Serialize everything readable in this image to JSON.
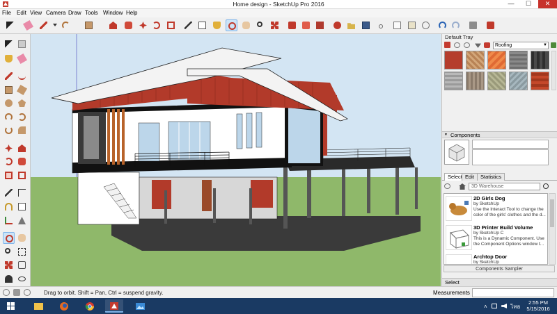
{
  "window": {
    "title": "Home design - SketchUp Pro 2016",
    "minimize": "—",
    "maximize": "☐",
    "close": "✕"
  },
  "menu": [
    "File",
    "Edit",
    "View",
    "Camera",
    "Draw",
    "Tools",
    "Window",
    "Help"
  ],
  "tray": {
    "title": "Default Tray",
    "material_library": "Roofing",
    "components_header": "Components",
    "tabs": [
      "Select",
      "Edit",
      "Statistics"
    ],
    "search_placeholder": "3D Warehouse",
    "results": [
      {
        "title": "2D Girls Dog",
        "by": "by SketchUp",
        "desc": "Use the Interact Tool to change the color of the girls' clothes and the d..."
      },
      {
        "title": "3D Printer Build Volume",
        "by": "by SketchUp C",
        "desc": "This is a Dynamic Component. Use the Component Options window t..."
      },
      {
        "title": "Archtop Door",
        "by": "by SketchUp",
        "desc": ""
      }
    ],
    "sampler": "Components Sampler",
    "select_bar": "Select"
  },
  "status": {
    "message": "Drag to orbit. Shift = Pan, Ctrl = suspend gravity.",
    "measurements_label": "Measurements"
  },
  "taskbar": {
    "time": "2:55 PM",
    "date": "5/15/2016"
  },
  "colors": {
    "sky": "#cfe1f1",
    "ground": "#8fb86a",
    "roof_red": "#b23a2a",
    "taskbar": "#1a3a63",
    "close_red": "#c7312b"
  }
}
